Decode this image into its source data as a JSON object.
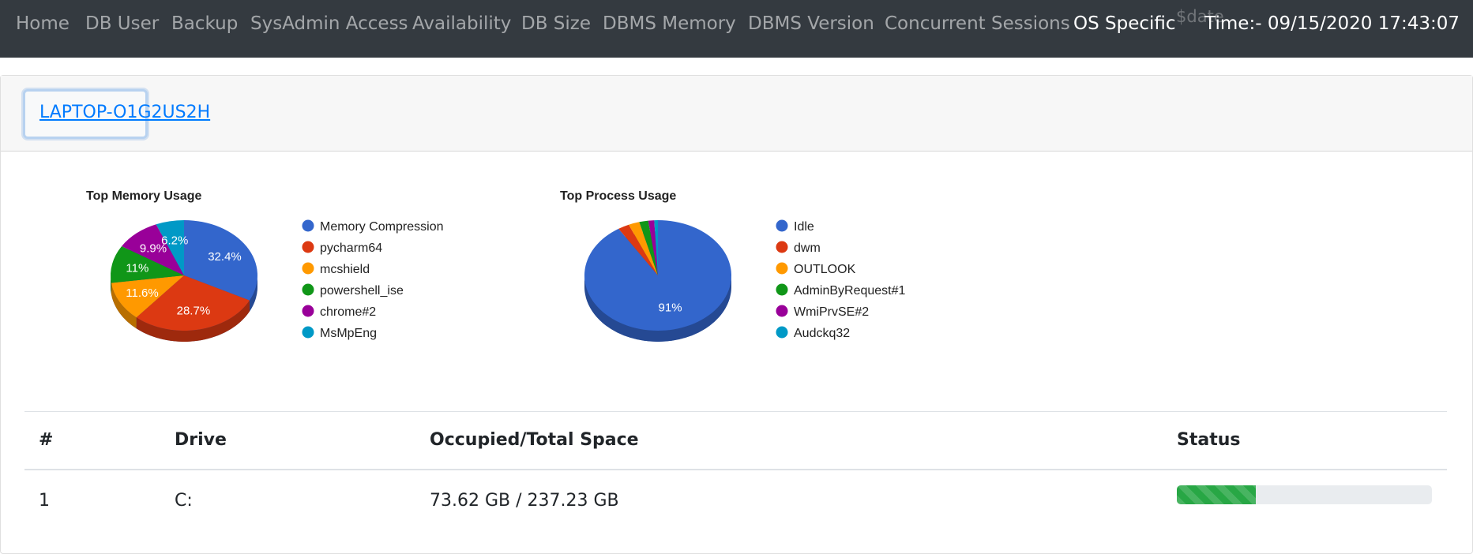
{
  "nav": {
    "items": [
      "Home",
      "DB User",
      "Backup",
      "SysAdmin Access",
      "Availability",
      "DB Size",
      "DBMS Memory",
      "DBMS Version",
      "Concurrent Sessions",
      "OS Specific"
    ],
    "active": "OS Specific",
    "date_placeholder": "$date",
    "time": "Time:- 09/15/2020 17:43:07"
  },
  "host": {
    "name": "LAPTOP-O1G2US2H"
  },
  "chart_data": [
    {
      "type": "pie",
      "title": "Top Memory Usage",
      "labels": [
        "Memory Compression",
        "pycharm64",
        "mcshield",
        "powershell_ise",
        "chrome#2",
        "MsMpEng"
      ],
      "values": [
        32.4,
        28.7,
        11.6,
        11.0,
        9.9,
        6.2
      ],
      "slice_labels": [
        "32.4%",
        "28.7%",
        "11.6%",
        "11%",
        "9.9%",
        "6.2%"
      ],
      "legend_position": "right",
      "style": "3d"
    },
    {
      "type": "pie",
      "title": "Top Process Usage",
      "labels": [
        "Idle",
        "dwm",
        "OUTLOOK",
        "AdminByRequest#1",
        "WmiPrvSE#2",
        "Audckq32"
      ],
      "values": [
        91.0,
        2.5,
        2.4,
        2.0,
        1.3,
        0.8
      ],
      "slice_labels": [
        "91%",
        "",
        "",
        "",
        "",
        ""
      ],
      "legend_position": "right",
      "style": "3d"
    }
  ],
  "colors": [
    "#3366cc",
    "#dc3912",
    "#ff9900",
    "#109618",
    "#990099",
    "#0099c6"
  ],
  "table": {
    "headers": [
      "#",
      "Drive",
      "Occupied/Total Space",
      "Status"
    ],
    "rows": [
      {
        "index": "1",
        "drive": "C:",
        "space": "73.62 GB / 237.23 GB",
        "usage": 0.3103
      }
    ]
  }
}
